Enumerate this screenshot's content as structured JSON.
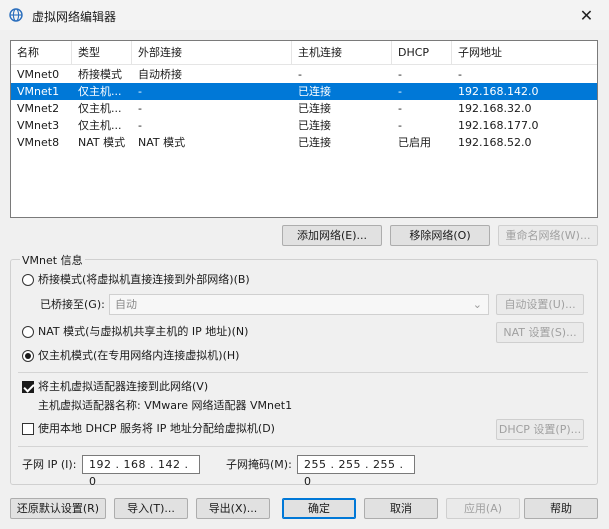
{
  "window": {
    "title": "虚拟网络编辑器",
    "close_glyph": "✕"
  },
  "list": {
    "columns": [
      "名称",
      "类型",
      "外部连接",
      "主机连接",
      "DHCP",
      "子网地址"
    ],
    "rows": [
      {
        "name": "VMnet0",
        "type": "桥接模式",
        "external": "自动桥接",
        "host": "-",
        "dhcp": "-",
        "subnet": "-"
      },
      {
        "name": "VMnet1",
        "type": "仅主机...",
        "external": "-",
        "host": "已连接",
        "dhcp": "-",
        "subnet": "192.168.142.0"
      },
      {
        "name": "VMnet2",
        "type": "仅主机...",
        "external": "-",
        "host": "已连接",
        "dhcp": "-",
        "subnet": "192.168.32.0"
      },
      {
        "name": "VMnet3",
        "type": "仅主机...",
        "external": "-",
        "host": "已连接",
        "dhcp": "-",
        "subnet": "192.168.177.0"
      },
      {
        "name": "VMnet8",
        "type": "NAT 模式",
        "external": "NAT 模式",
        "host": "已连接",
        "dhcp": "已启用",
        "subnet": "192.168.52.0"
      }
    ],
    "selected_index": 1
  },
  "net_buttons": {
    "add": "添加网络(E)...",
    "remove": "移除网络(O)",
    "rename": "重命名网络(W)..."
  },
  "vmnet_info": {
    "label": "VMnet 信息",
    "bridge_radio": "桥接模式(将虚拟机直接连接到外部网络)(B)",
    "bridged_to_label": "已桥接至(G):",
    "bridged_to_value": "自动",
    "auto_settings": "自动设置(U)...",
    "nat_radio": "NAT 模式(与虚拟机共享主机的 IP 地址)(N)",
    "nat_settings": "NAT 设置(S)...",
    "hostonly_radio": "仅主机模式(在专用网络内连接虚拟机)(H)",
    "connect_adapter_chk": "将主机虚拟适配器连接到此网络(V)",
    "adapter_name_line": "主机虚拟适配器名称: VMware 网络适配器 VMnet1",
    "dhcp_chk": "使用本地 DHCP 服务将 IP 地址分配给虚拟机(D)",
    "dhcp_settings": "DHCP 设置(P)...",
    "subnet_ip_label": "子网 IP (I):",
    "subnet_ip_value": "192 . 168 . 142 . 0",
    "subnet_mask_label": "子网掩码(M):",
    "subnet_mask_value": "255 . 255 . 255 . 0"
  },
  "footer": {
    "restore": "还原默认设置(R)",
    "import": "导入(T)...",
    "export": "导出(X)...",
    "ok": "确定",
    "cancel": "取消",
    "apply": "应用(A)",
    "help": "帮助"
  },
  "colors": {
    "selection": "#0078d7",
    "icon": "#2a6ebd"
  }
}
